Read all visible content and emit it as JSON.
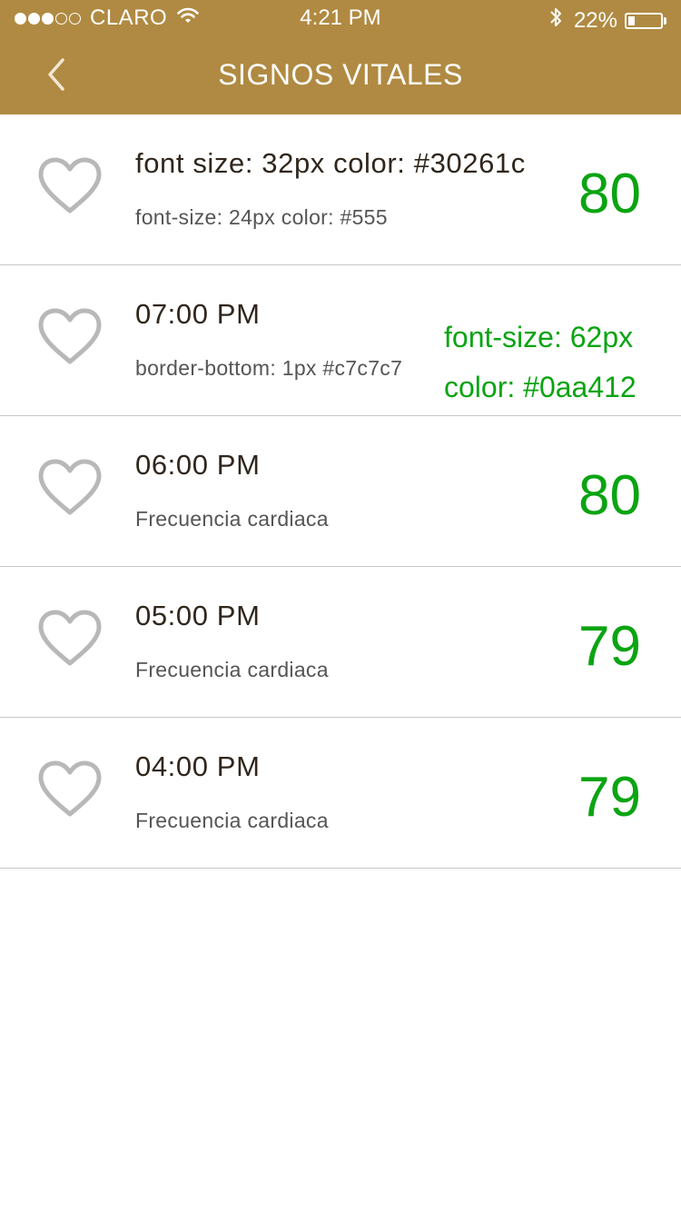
{
  "status_bar": {
    "carrier": "CLARO",
    "time": "4:21 PM",
    "battery_percent": "22%",
    "battery_level": 0.22,
    "signal_bars_filled": 3,
    "signal_bars_total": 5
  },
  "nav": {
    "title": "SIGNOS VITALES",
    "back_icon": "chevron-left-icon"
  },
  "colors": {
    "header_bg": "#b08a42",
    "title_text": "#30261c",
    "sub_text": "#555555",
    "value_text": "#0aa412",
    "divider": "#c7c7c7",
    "heart_icon": "#b8b8b8"
  },
  "rows": [
    {
      "title": "font size: 32px color: #30261c",
      "subtitle": "font-size: 24px color: #555",
      "value": "80"
    },
    {
      "title": "07:00 PM",
      "subtitle": "border-bottom: 1px #c7c7c7",
      "value_note_1": "font-size: 62px",
      "value_note_2": "color: #0aa412"
    },
    {
      "title": "06:00 PM",
      "subtitle": "Frecuencia cardiaca",
      "value": "80"
    },
    {
      "title": "05:00 PM",
      "subtitle": "Frecuencia cardiaca",
      "value": "79"
    },
    {
      "title": "04:00 PM",
      "subtitle": "Frecuencia cardiaca",
      "value": "79"
    }
  ]
}
